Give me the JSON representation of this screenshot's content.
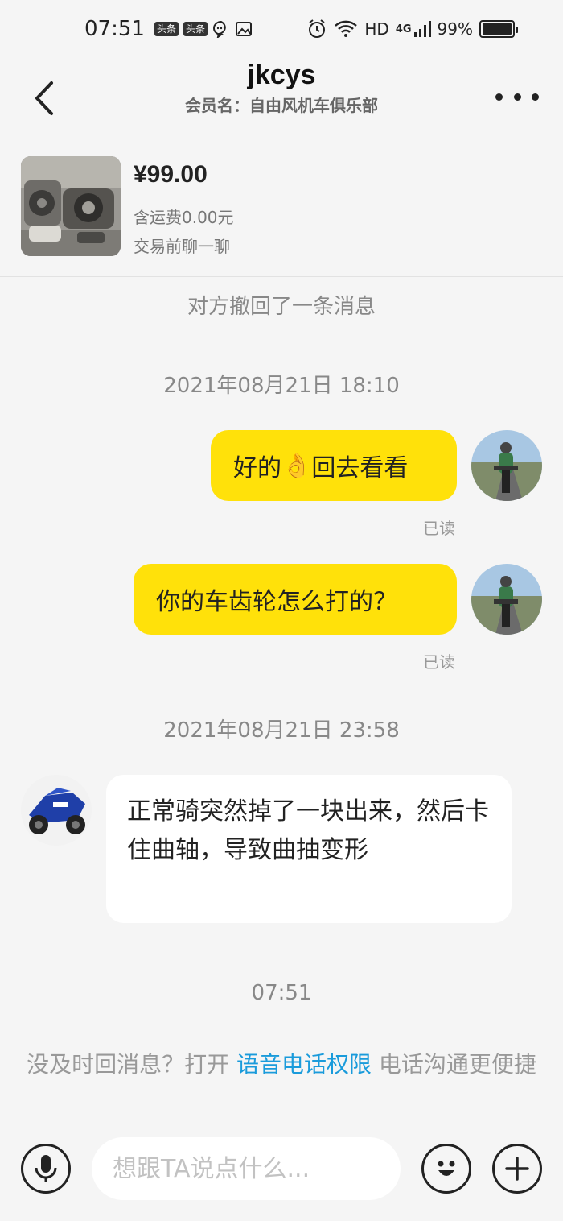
{
  "status_bar": {
    "time": "07:51",
    "badge1": "头条",
    "badge2": "头条",
    "network": "HD",
    "signal": "4G",
    "battery": "99%",
    "battery_level": 0.99
  },
  "header": {
    "title": "jkcys",
    "subtitle": "会员名：自由风机车俱乐部"
  },
  "product": {
    "price": "¥99.00",
    "shipping": "含运费0.00元",
    "hint": "交易前聊一聊"
  },
  "system": {
    "recalled": "对方撤回了一条消息",
    "timestamp1": "2021年08月21日 18:10",
    "timestamp2": "2021年08月21日 23:58",
    "timestamp3": "07:51"
  },
  "messages": [
    {
      "direction": "out",
      "text_before": "好的",
      "emoji": "👌",
      "text_after": "回去看看",
      "status": "已读"
    },
    {
      "direction": "out",
      "text": "你的车齿轮怎么打的？",
      "status": "已读"
    },
    {
      "direction": "in",
      "text": "正常骑突然掉了一块出来，然后卡住曲轴，导致曲抽变形"
    }
  ],
  "voice_tip": {
    "before": "没及时回消息？打开 ",
    "link": "语音电话权限",
    "after": " 电话沟通更便捷"
  },
  "input_bar": {
    "placeholder": "想跟TA说点什么..."
  },
  "icons": {
    "back": "back-arrow-icon",
    "more": "more-dots-icon",
    "mic": "microphone-icon",
    "emoji": "smiley-icon",
    "plus": "plus-icon"
  },
  "colors": {
    "bubble_out": "#ffe10a",
    "bubble_in": "#ffffff",
    "link": "#1a9bdb",
    "background": "#f5f5f5"
  }
}
